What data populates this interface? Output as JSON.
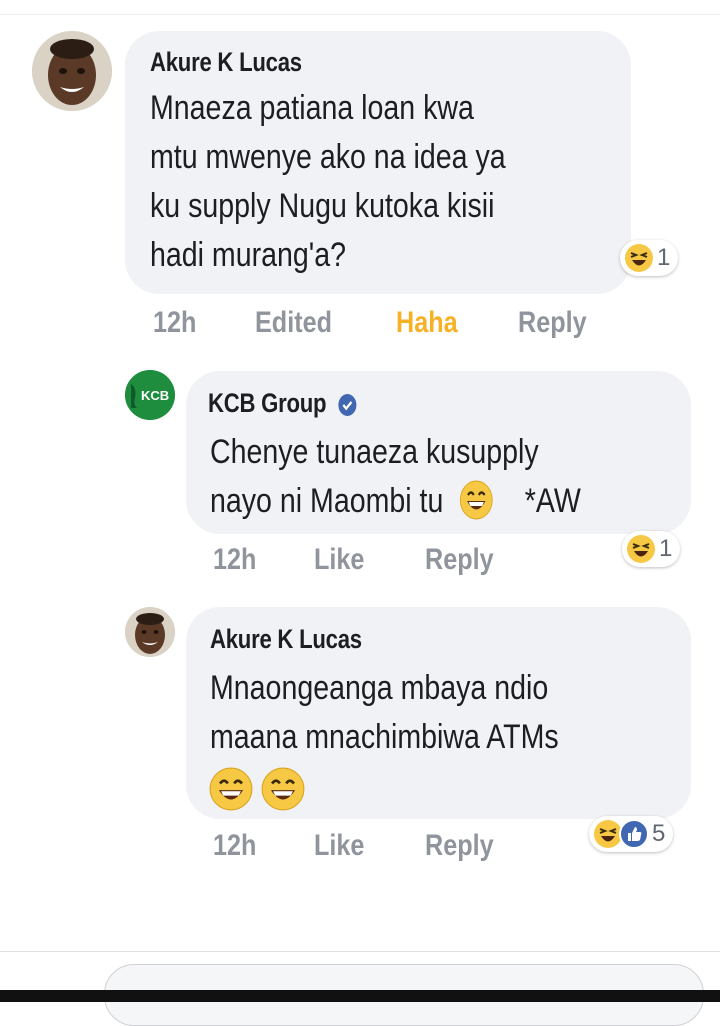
{
  "comments": [
    {
      "author": "Akure K Lucas",
      "lines": [
        "Mnaeza patiana loan  kwa",
        "mtu mwenye ako na idea ya",
        "ku supply Nugu kutoka kisii",
        "hadi murang'a?"
      ],
      "reaction_count": "1",
      "meta": {
        "time": "12h",
        "edited": "Edited",
        "reaction": "Haha",
        "reply": "Reply"
      }
    },
    {
      "author": "KCB Group",
      "lines": [
        "Chenye tunaeza kusupply",
        "nayo ni Maombi tu",
        "*AW"
      ],
      "reaction_count": "1",
      "meta": {
        "time": "12h",
        "like": "Like",
        "reply": "Reply"
      }
    },
    {
      "author": "Akure K Lucas",
      "lines": [
        "Mnaongeanga mbaya ndio",
        "maana mnachimbiwa ATMs"
      ],
      "reaction_count": "5",
      "meta": {
        "time": "12h",
        "like": "Like",
        "reply": "Reply"
      }
    }
  ],
  "kcb_logo_text": "KCB",
  "colors": {
    "bubble": "#f1f2f6",
    "meta": "#90949c",
    "haha": "#f7b125",
    "verified": "#4267b2",
    "kcb_green": "#1e8e3e"
  }
}
